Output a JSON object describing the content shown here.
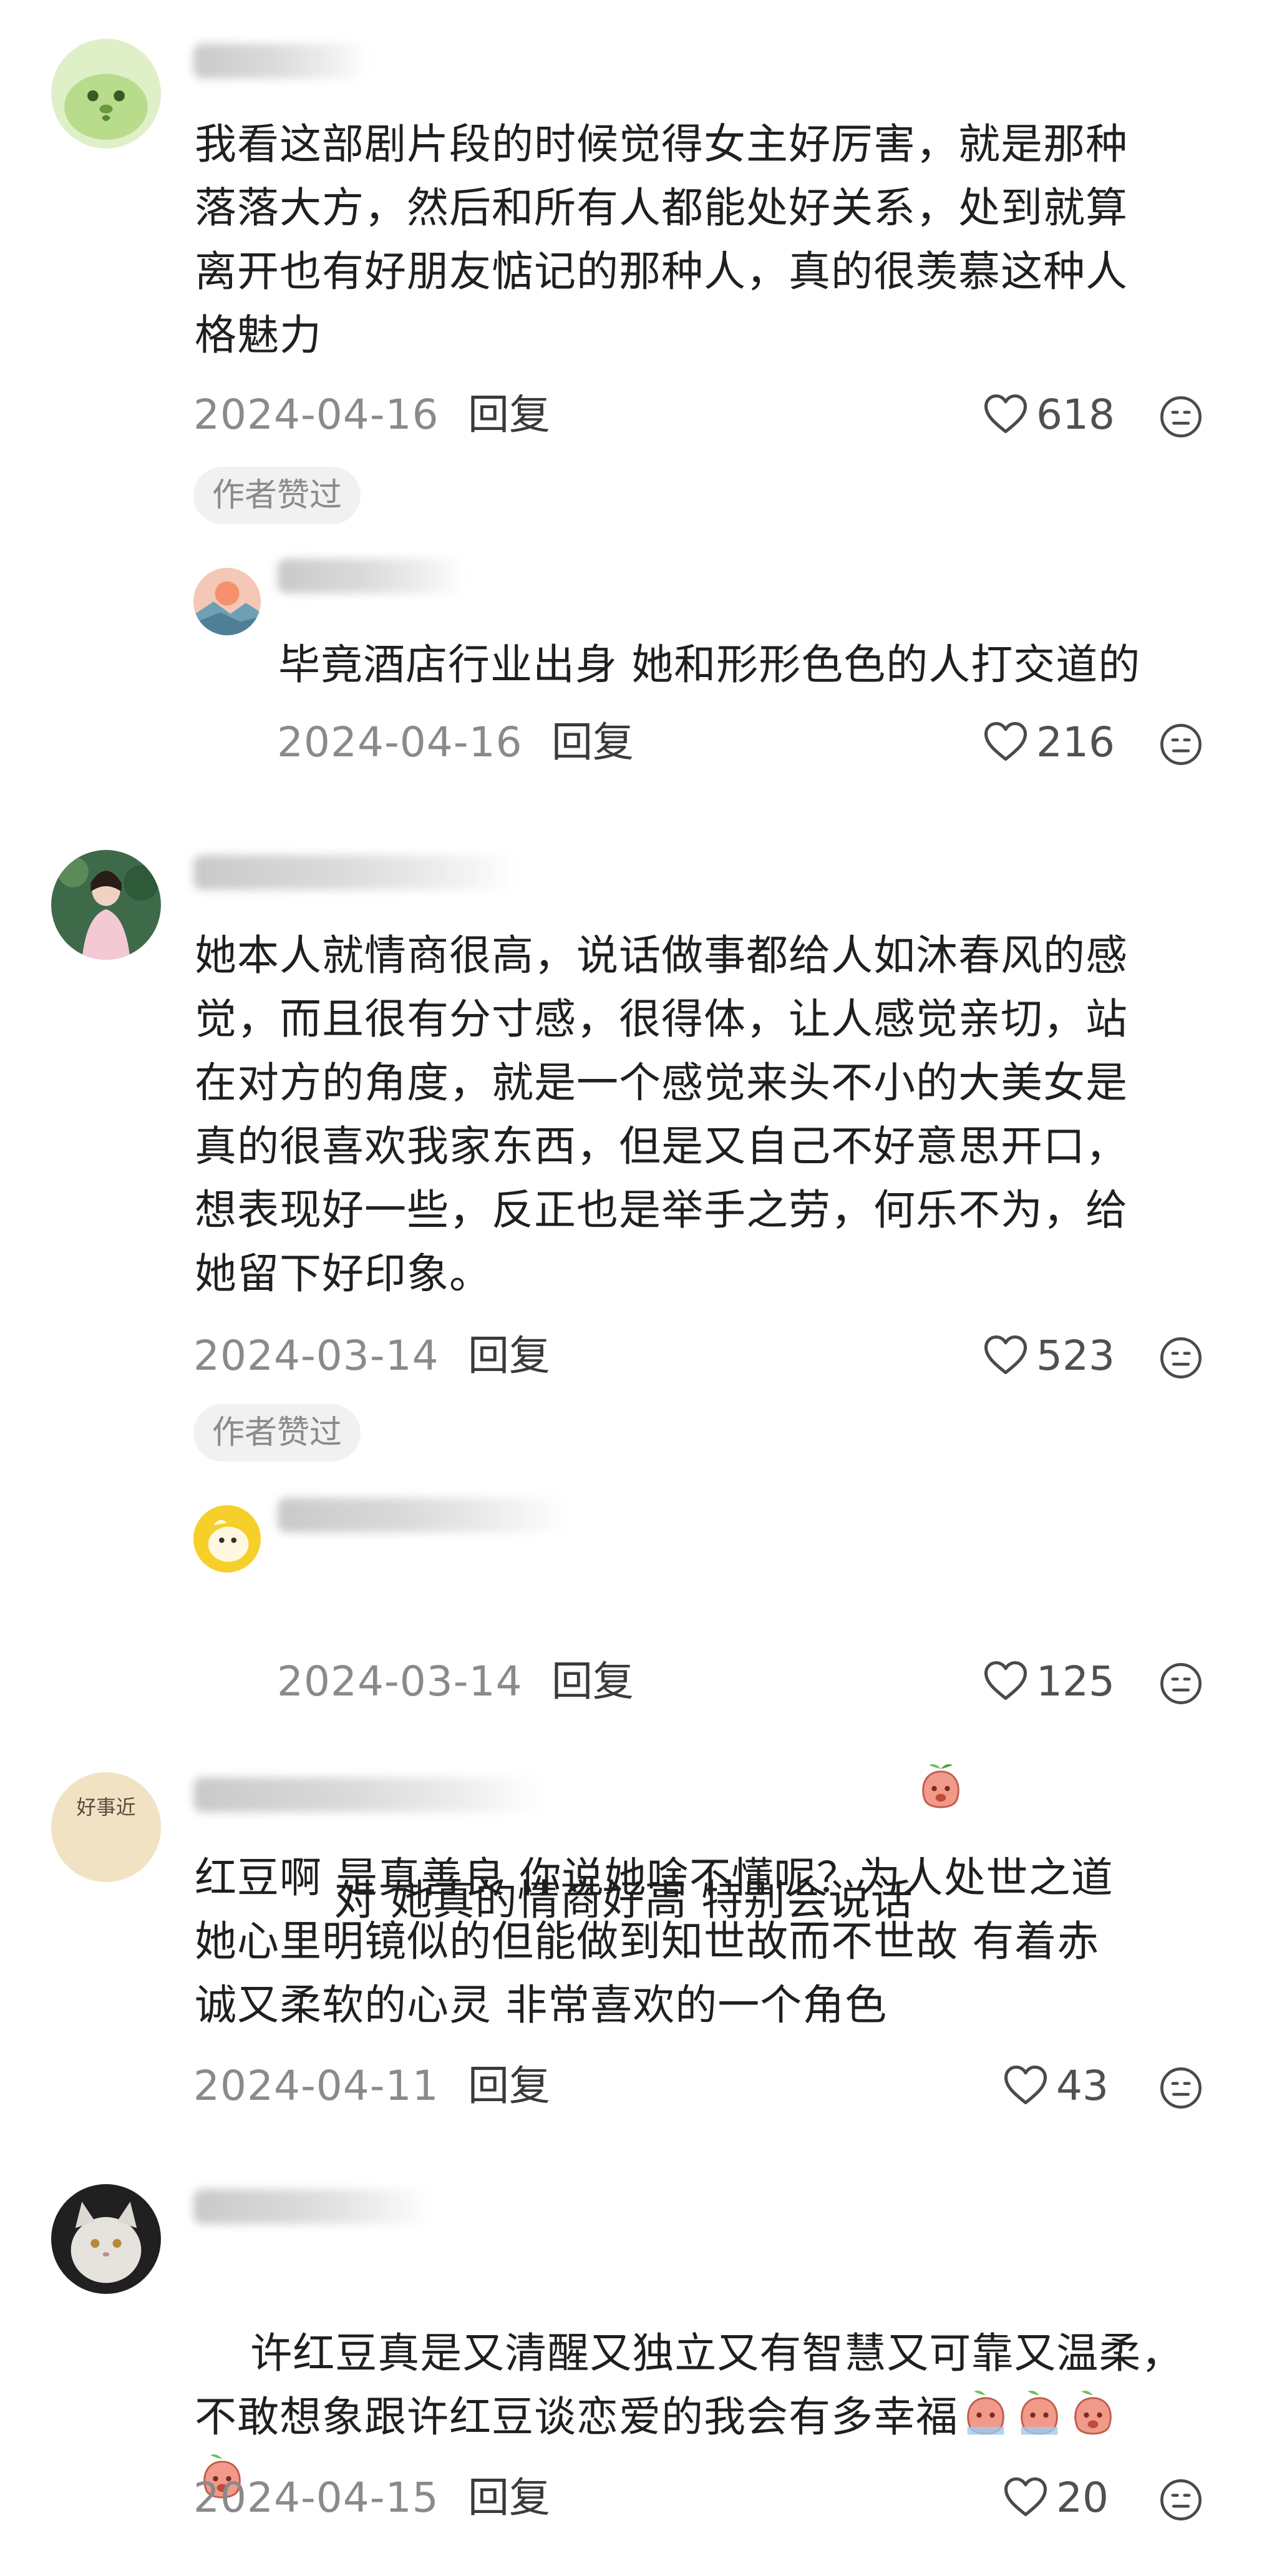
{
  "comments": [
    {
      "text": "我看这部剧片段的时候觉得女主好厉害，就是那种\n落落大方，然后和所有人都能处好关系，处到就算\n离开也有好朋友惦记的那种人，真的很羡慕这种人\n格魅力",
      "date": "2024-04-16",
      "reply_label": "回复",
      "likes": "618",
      "badge": "作者赞过",
      "reply": {
        "text": "毕竟酒店行业出身 她和形形色色的人打交道的",
        "date": "2024-04-16",
        "reply_label": "回复",
        "likes": "216"
      }
    },
    {
      "text": "她本人就情商很高，说话做事都给人如沐春风的感\n觉，而且很有分寸感，很得体，让人感觉亲切，站\n在对方的角度，就是一个感觉来头不小的大美女是\n真的很喜欢我家东西，但是又自己不好意思开口，\n想表现好一些，反正也是举手之劳，何乐不为，给\n她留下好印象。",
      "date": "2024-03-14",
      "reply_label": "回复",
      "likes": "523",
      "badge": "作者赞过",
      "reply": {
        "text": "对 她真的情商好高 特别会说话",
        "date": "2024-03-14",
        "reply_label": "回复",
        "likes": "125"
      }
    },
    {
      "text": "红豆啊 是真善良 你说她啥不懂呢？为人处世之道\n她心里明镜似的但能做到知世故而不世故 有着赤\n诚又柔软的心灵 非常喜欢的一个角色",
      "date": "2024-04-11",
      "reply_label": "回复",
      "likes": "43",
      "avatar_text": "好事近"
    },
    {
      "text": "许红豆真是又清醒又独立又有智慧又可靠又温柔，\n不敢想象跟许红豆谈恋爱的我会有多幸福",
      "date": "2024-04-15",
      "reply_label": "回复",
      "likes": "20"
    }
  ],
  "icons": {
    "like": "heart-outline-icon",
    "dislike": "unhappy-face-icon",
    "emoji": "peach-sticker-icon"
  },
  "colors": {
    "text": "#1f1f1f",
    "meta": "#8a8a8a",
    "badge_bg": "#f1f1f1"
  }
}
